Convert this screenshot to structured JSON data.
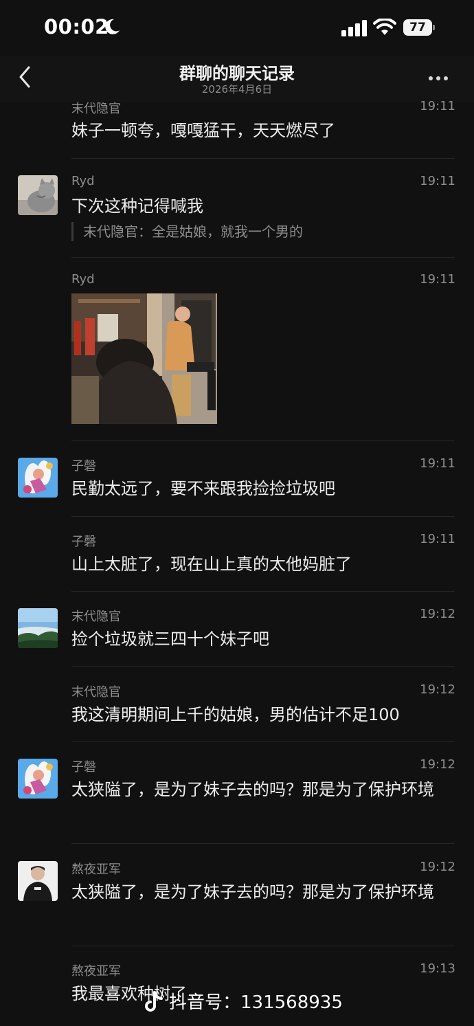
{
  "status": {
    "time": "00:02",
    "battery": "77"
  },
  "header": {
    "title": "群聊的聊天记录",
    "subtitle": "2026年4月6日"
  },
  "messages": [
    {
      "sender": "末代隐官",
      "time": "19:11",
      "text": "妹子一顿夸，嘎嘎猛干，天天燃尽了"
    },
    {
      "sender": "Ryd",
      "time": "19:11",
      "text": "下次这种记得喊我",
      "quote": "末代隐官：全是姑娘，就我一个男的"
    },
    {
      "sender": "Ryd",
      "time": "19:11"
    },
    {
      "sender": "子磬",
      "time": "19:11",
      "text": "民勤太远了，要不来跟我捡捡垃圾吧"
    },
    {
      "sender": "子磬",
      "time": "19:11",
      "text": "山上太脏了，现在山上真的太他妈脏了"
    },
    {
      "sender": "末代隐官",
      "time": "19:12",
      "text": "捡个垃圾就三四十个妹子吧"
    },
    {
      "sender": "末代隐官",
      "time": "19:12",
      "text": "我这清明期间上千的姑娘，男的估计不足100"
    },
    {
      "sender": "子磬",
      "time": "19:12",
      "text": "太狭隘了，是为了妹子去的吗？那是为了保护环境"
    },
    {
      "sender": "熬夜亚军",
      "time": "19:12",
      "text": "太狭隘了，是为了妹子去的吗？那是为了保护环境"
    },
    {
      "sender": "熬夜亚军",
      "time": "19:13",
      "text": "我最喜欢种树了"
    }
  ],
  "watermark": {
    "text": "抖音号：131568935"
  },
  "icons": {
    "back": "chevron-left-icon",
    "more": "more-dots-icon",
    "signal": "signal-icon",
    "wifi": "wifi-icon",
    "moon": "moon-icon",
    "battery": "battery-icon"
  }
}
